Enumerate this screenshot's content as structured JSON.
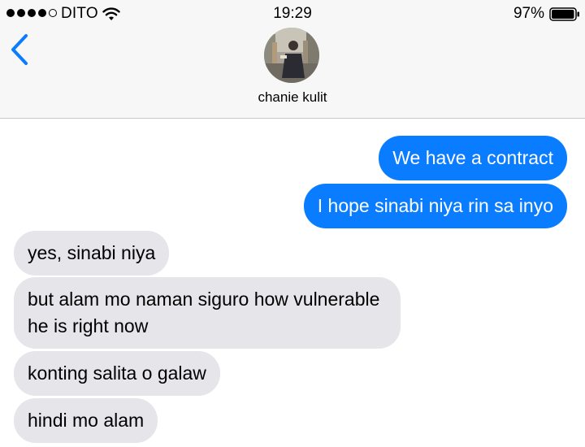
{
  "status_bar": {
    "carrier": "DITO",
    "time": "19:29",
    "battery_percent": "97%",
    "signal_bars_filled": 4,
    "signal_bars_total": 5
  },
  "header": {
    "contact_name": "chanie kulit",
    "back_icon": "chevron-left-icon"
  },
  "colors": {
    "sent_bubble": "#0a7cff",
    "received_bubble": "#e5e5ea",
    "accent": "#0a7cff"
  },
  "messages": [
    {
      "direction": "sent",
      "text": "We have a contract"
    },
    {
      "direction": "sent",
      "text": "I hope sinabi niya rin sa inyo"
    },
    {
      "direction": "received",
      "text": "yes, sinabi niya"
    },
    {
      "direction": "received",
      "text": "but alam mo naman siguro how vulnerable he is right now"
    },
    {
      "direction": "received",
      "text": "konting salita o galaw"
    },
    {
      "direction": "received",
      "text": "hindi mo alam"
    }
  ]
}
